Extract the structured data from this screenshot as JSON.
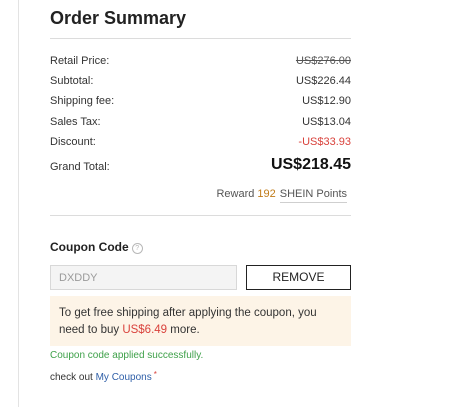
{
  "order_summary": {
    "title": "Order Summary",
    "rows": [
      {
        "label": "Retail Price:",
        "value": "US$276.00"
      },
      {
        "label": "Subtotal:",
        "value": "US$226.44"
      },
      {
        "label": "Shipping fee:",
        "value": "US$12.90"
      },
      {
        "label": "Sales Tax:",
        "value": "US$13.04"
      },
      {
        "label": "Discount:",
        "value": "-US$33.93"
      }
    ],
    "grand_total": {
      "label": "Grand Total:",
      "value": "US$218.45"
    },
    "reward": {
      "prefix": "Reward",
      "points": "192",
      "suffix": "SHEIN Points"
    }
  },
  "coupon": {
    "title": "Coupon Code",
    "info_icon": "info-icon",
    "input_value": "DXDDY",
    "remove_label": "REMOVE",
    "notice": {
      "text_before": "To get free shipping after applying the coupon, you need to buy",
      "amount": "US$6.49",
      "text_after": "more."
    },
    "success_message": "Coupon code applied successfully.",
    "checkout_text": "check out",
    "my_coupons_link": "My Coupons",
    "required_mark": "*"
  },
  "colors": {
    "discount": "#d9413b",
    "reward_points": "#c07a17",
    "notice_background": "#fdf4e7",
    "success": "#3fa14a",
    "link": "#2f5fa8"
  }
}
